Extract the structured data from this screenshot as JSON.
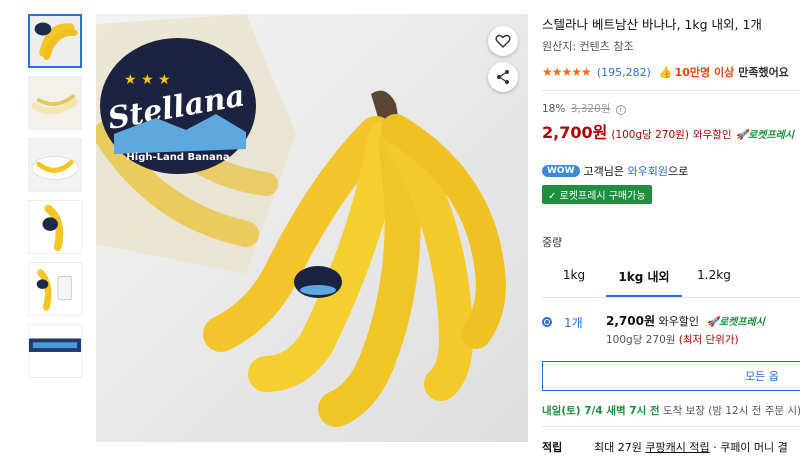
{
  "product": {
    "title": "스텔라나 베트남산 바나나, 1kg 내외, 1개",
    "origin": "원산지: 컨텐츠 참조",
    "stars": "★★★★★",
    "review_count": "(195,282)",
    "buyers_icon": "thumbs-up-icon",
    "buyers_emph": "10만명 이상",
    "buyers_tail": "만족했어요"
  },
  "pricing": {
    "discount_rate": "18%",
    "original_price": "3,320원",
    "price": "2,700원",
    "unit_price": "(100g당 270원)",
    "wow_discount": "와우할인",
    "rocket_fresh": "로켓프레시"
  },
  "wow": {
    "badge": "WOW",
    "prefix": "고객님은",
    "link": "와우회원",
    "suffix": "으로",
    "rocket_buy": "✓ 로켓프레시 구매가능"
  },
  "weight": {
    "label": "중량",
    "tabs": [
      "1kg",
      "1kg 내외",
      "1.2kg"
    ],
    "active_index": 1
  },
  "option": {
    "label": "1개",
    "price": "2,700원",
    "wow": "와우할인",
    "rocket": "로켓프레시",
    "unit": "100g당 270원",
    "lowest": "(최저 단위가)"
  },
  "actions": {
    "all_options": "모든 옵"
  },
  "delivery": {
    "date": "내일(토) 7/4 새벽 7시 전",
    "guarantee": "도착 보장",
    "note": "(밤 12시 전 주문 시)"
  },
  "points": {
    "label": "적립",
    "max": "최대 27원",
    "coupang_cash": "쿠팡캐시 적립",
    "tail": "· 쿠페이 머니 결"
  },
  "main_image": {
    "brand": "Stellana",
    "subbrand": "High-Land Banana"
  },
  "colors": {
    "accent": "#2b6fd6",
    "price_red": "#ae0000",
    "rocket_green": "#1f8f3c",
    "star_orange": "#f36b1c"
  }
}
